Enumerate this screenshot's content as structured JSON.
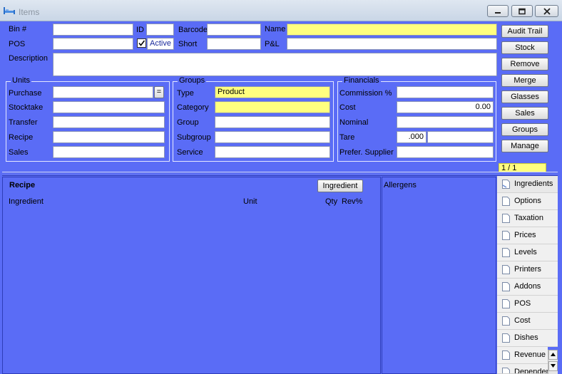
{
  "window": {
    "title": "Items"
  },
  "labels": {
    "bin": "Bin #",
    "id": "ID",
    "barcode": "Barcode",
    "name": "Name",
    "pos": "POS",
    "active": "Active",
    "short": "Short",
    "pl": "P&L",
    "description": "Description"
  },
  "fields": {
    "type": "Product",
    "cost": "0.00",
    "tare": ".000"
  },
  "units": {
    "title": "Units",
    "purchase": "Purchase",
    "stocktake": "Stocktake",
    "transfer": "Transfer",
    "recipe": "Recipe",
    "sales": "Sales",
    "equals_btn": "="
  },
  "groups": {
    "title": "Groups",
    "type": "Type",
    "category": "Category",
    "group": "Group",
    "subgroup": "Subgroup",
    "service": "Service"
  },
  "financials": {
    "title": "Financials",
    "commission": "Commission %",
    "cost": "Cost",
    "nominal": "Nominal",
    "tare": "Tare",
    "supplier": "Prefer. Supplier"
  },
  "buttons": {
    "audit_trail": "Audit Trail",
    "stock": "Stock",
    "remove": "Remove",
    "merge": "Merge",
    "glasses": "Glasses",
    "sales": "Sales",
    "groups": "Groups",
    "manage": "Manage"
  },
  "record_counter": "1 / 1",
  "recipe": {
    "title": "Recipe",
    "ingredient_btn": "Ingredient",
    "col_ingredient": "Ingredient",
    "col_unit": "Unit",
    "col_qty": "Qty",
    "col_rev": "Rev%"
  },
  "allergens": {
    "title": "Allergens"
  },
  "tabs": [
    "Ingredients",
    "Options",
    "Taxation",
    "Prices",
    "Levels",
    "Printers",
    "Addons",
    "POS",
    "Cost",
    "Dishes",
    "Revenue",
    "Depender"
  ],
  "colors": {
    "background": "#5a6cf6",
    "highlight_field": "#ffff7f"
  }
}
